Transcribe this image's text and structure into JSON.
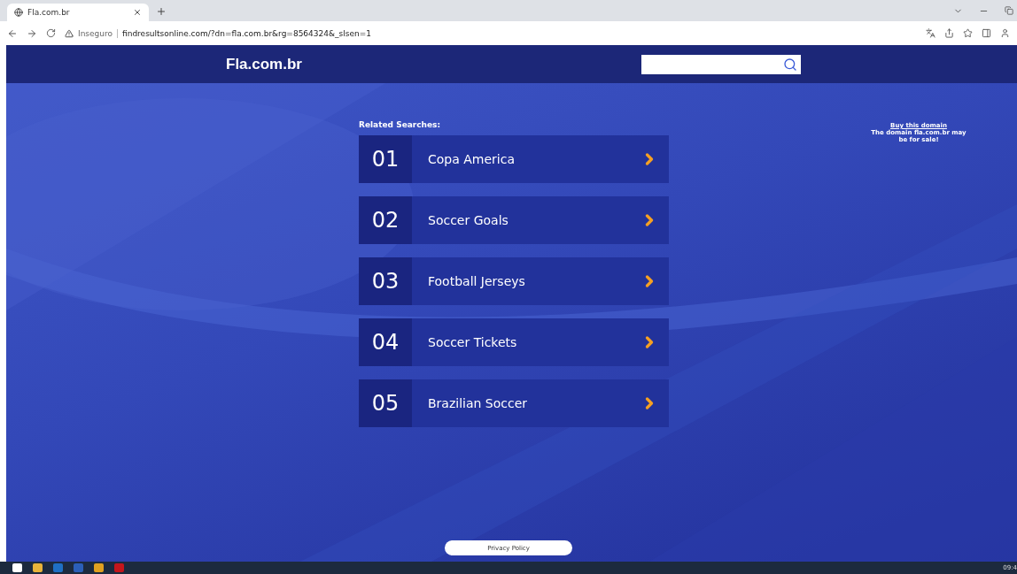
{
  "browser": {
    "tab_title": "Fla.com.br",
    "security_label": "Inseguro",
    "url": "findresultsonline.com/?dn=fla.com.br&rg=8564324&_slsen=1"
  },
  "header": {
    "logo": "Fla.com.br"
  },
  "related": {
    "title": "Related Searches:",
    "items": [
      {
        "number": "01",
        "label": "Copa America"
      },
      {
        "number": "02",
        "label": "Soccer Goals"
      },
      {
        "number": "03",
        "label": "Football Jerseys"
      },
      {
        "number": "04",
        "label": "Soccer Tickets"
      },
      {
        "number": "05",
        "label": "Brazilian Soccer"
      }
    ]
  },
  "sale": {
    "link": "Buy this domain",
    "text": "The domain fla.com.br may be for sale!"
  },
  "footer": {
    "privacy": "Privacy Policy"
  },
  "taskbar": {
    "clock": "09:4"
  }
}
